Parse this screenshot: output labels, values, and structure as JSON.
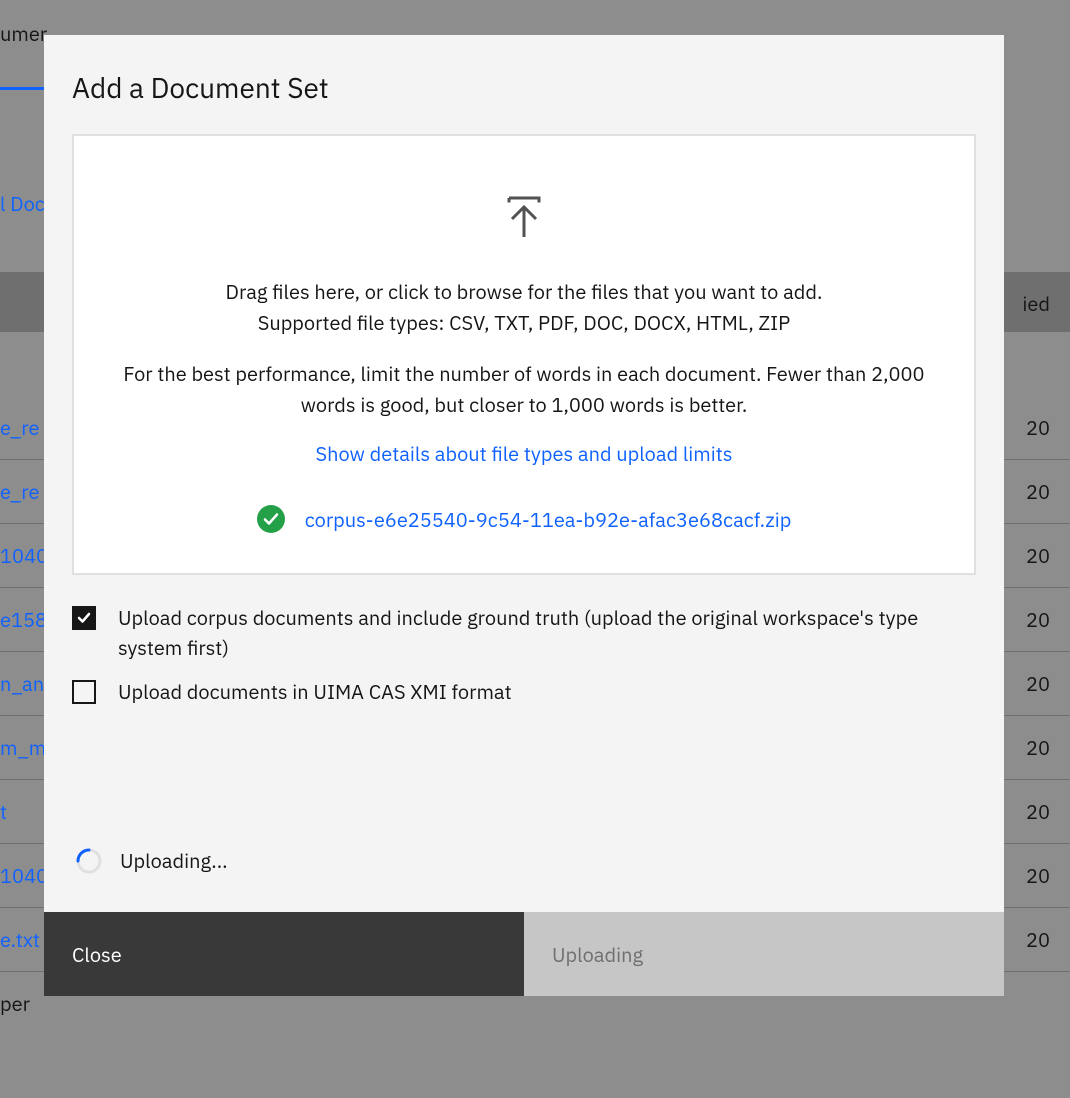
{
  "background": {
    "tab_label": "umer",
    "toolbar_link": "l Doc",
    "header_right": "ied",
    "rows": [
      {
        "link": "e_re",
        "date": "20"
      },
      {
        "link": "e_re",
        "date": "20"
      },
      {
        "link": "1040",
        "date": "20"
      },
      {
        "link": "e158",
        "date": "20"
      },
      {
        "link": "n_an",
        "date": "20"
      },
      {
        "link": "m_m",
        "date": "20"
      },
      {
        "link": "t",
        "date": "20"
      },
      {
        "link": "1040",
        "date": "20"
      },
      {
        "link": "e.txt",
        "date": "20"
      }
    ],
    "footer": "per"
  },
  "modal": {
    "title": "Add a Document Set",
    "dropzone": {
      "line1": "Drag files here, or click to browse for the files that you want to add.",
      "line2": "Supported file types: CSV, TXT, PDF, DOC, DOCX, HTML, ZIP",
      "performance_note": "For the best performance, limit the number of words in each document. Fewer than 2,000 words is good, but closer to 1,000 words is better.",
      "details_link": "Show details about file types and upload limits",
      "uploaded_file": "corpus-e6e25540-9c54-11ea-b92e-afac3e68cacf.zip"
    },
    "checkboxes": {
      "ground_truth": {
        "label": "Upload corpus documents and include ground truth (upload the original workspace's type system first)",
        "checked": true
      },
      "uima": {
        "label": "Upload documents in UIMA CAS XMI format",
        "checked": false
      }
    },
    "status": "Uploading...",
    "buttons": {
      "close": "Close",
      "upload": "Uploading"
    }
  }
}
